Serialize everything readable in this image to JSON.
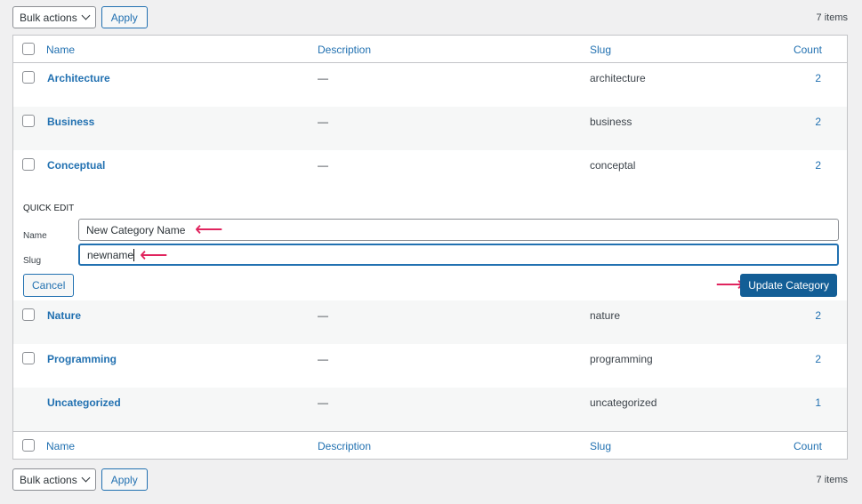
{
  "top_bar": {
    "bulk_actions": "Bulk actions",
    "apply": "Apply",
    "items_count": "7 items"
  },
  "bottom_bar": {
    "bulk_actions": "Bulk actions",
    "apply": "Apply",
    "items_count": "7 items"
  },
  "columns": {
    "name": "Name",
    "description": "Description",
    "slug": "Slug",
    "count": "Count"
  },
  "rows_before": [
    {
      "name": "Architecture",
      "description": "—",
      "slug": "architecture",
      "count": "2"
    },
    {
      "name": "Business",
      "description": "—",
      "slug": "business",
      "count": "2"
    },
    {
      "name": "Conceptual",
      "description": "—",
      "slug": "conceptal",
      "count": "2"
    }
  ],
  "quick_edit": {
    "title": "QUICK EDIT",
    "name_label": "Name",
    "name_value": "New Category Name",
    "slug_label": "Slug",
    "slug_value": "newname",
    "cancel": "Cancel",
    "update": "Update Category"
  },
  "rows_after": [
    {
      "name": "Nature",
      "description": "—",
      "slug": "nature",
      "count": "2"
    },
    {
      "name": "Programming",
      "description": "—",
      "slug": "programming",
      "count": "2"
    },
    {
      "name": "Uncategorized",
      "description": "—",
      "slug": "uncategorized",
      "count": "1"
    }
  ],
  "colors": {
    "accent": "#2271b1",
    "primary_button": "#135e96",
    "annotation_arrow": "#e0245e"
  }
}
